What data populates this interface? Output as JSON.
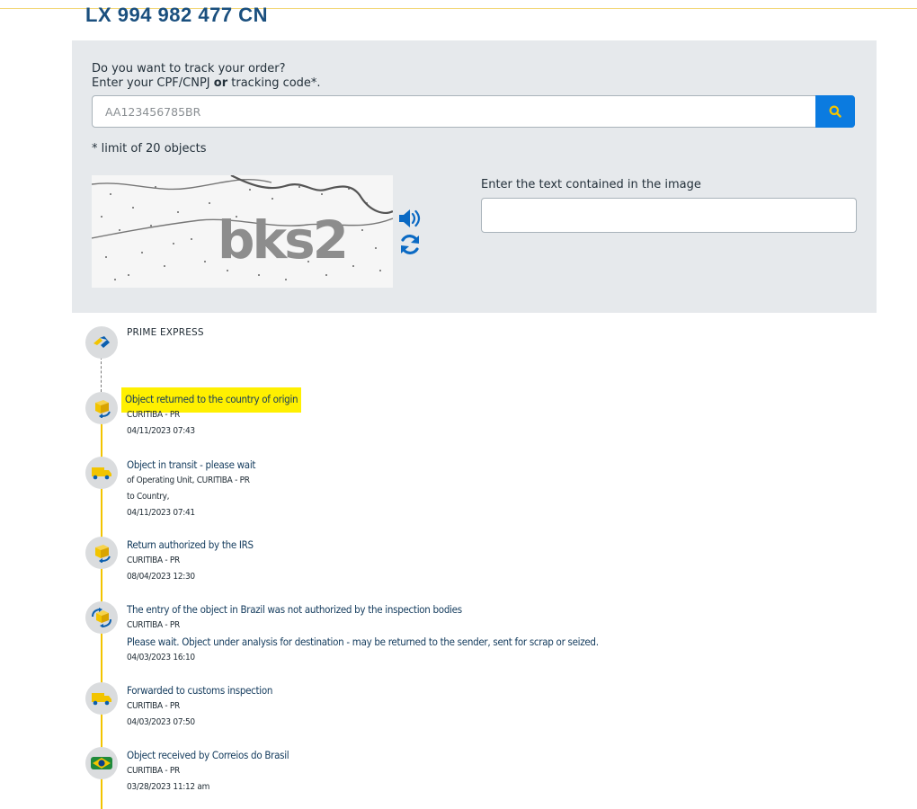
{
  "tracking_number": "LX 994 982 477 CN",
  "search": {
    "prompt_line1": "Do you want to track your order?",
    "prompt_line2_pre": "Enter your CPF/CNPJ ",
    "prompt_line2_bold": "or",
    "prompt_line2_post": " tracking code*.",
    "placeholder": "AA123456785BR",
    "limit_note": "* limit of 20 objects",
    "button_icon": "search-icon"
  },
  "captcha": {
    "image_text": "bks2",
    "label": "Enter the text contained in the image",
    "audio_icon": "speaker-icon",
    "refresh_icon": "refresh-icon"
  },
  "colors": {
    "accent_blue": "#0b7be0",
    "brand_yellow": "#f2c400",
    "panel_bg": "#e6e9ec",
    "title_blue": "#1a4f7e",
    "highlight": "#fff000"
  },
  "carrier": "PRIME EXPRESS",
  "events": [
    {
      "title": "Object returned to the country of origin",
      "lines": [
        "CURITIBA - PR"
      ],
      "note": "",
      "datetime": "04/11/2023 07:43",
      "icon": "box-return-icon",
      "highlighted": true
    },
    {
      "title": "Object in transit - please wait",
      "lines": [
        "of Operating Unit, CURITIBA - PR",
        "to Country,"
      ],
      "note": "",
      "datetime": "04/11/2023 07:41",
      "icon": "truck-icon",
      "highlighted": false
    },
    {
      "title": "Return authorized by the IRS",
      "lines": [
        "CURITIBA - PR"
      ],
      "note": "",
      "datetime": "08/04/2023 12:30",
      "icon": "box-return-icon",
      "highlighted": false
    },
    {
      "title": "The entry of the object in Brazil was not authorized by the inspection bodies",
      "lines": [
        "CURITIBA - PR"
      ],
      "note": "Please wait. Object under analysis for destination - may be returned to the sender, sent for scrap or seized.",
      "datetime": "04/03/2023 16:10",
      "icon": "box-arrows-icon",
      "highlighted": false
    },
    {
      "title": "Forwarded to customs inspection",
      "lines": [
        "CURITIBA - PR"
      ],
      "note": "",
      "datetime": "04/03/2023 07:50",
      "icon": "truck-icon",
      "highlighted": false
    },
    {
      "title": "Object received by Correios do Brasil",
      "lines": [
        "CURITIBA - PR"
      ],
      "note": "",
      "datetime": "03/28/2023 11:12 am",
      "icon": "brazil-flag-icon",
      "highlighted": false
    }
  ]
}
